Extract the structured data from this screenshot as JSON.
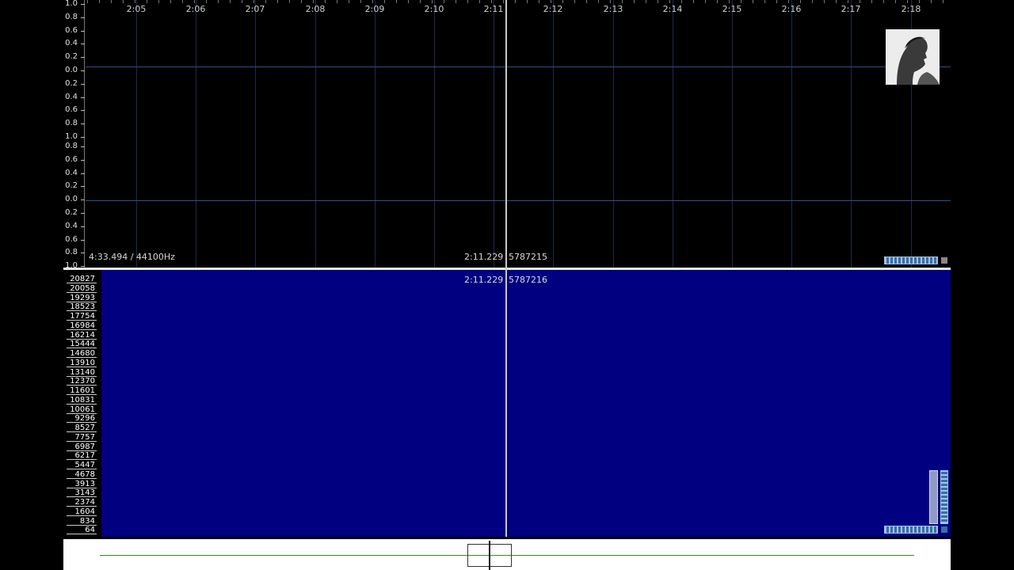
{
  "waveform": {
    "time_ticks": [
      "2:05",
      "2:06",
      "2:07",
      "2:08",
      "2:09",
      "2:10",
      "2:11",
      "2:12",
      "2:13",
      "2:14",
      "2:15",
      "2:16",
      "2:17",
      "2:18"
    ],
    "amplitude_labels_ch1": [
      "1.0",
      "0.8",
      "0.6",
      "0.4",
      "0.2",
      "0.0",
      "0.2",
      "0.4",
      "0.6",
      "0.8",
      "1.0"
    ],
    "amplitude_labels_ch2": [
      "0.8",
      "0.6",
      "0.4",
      "0.2",
      "0.0",
      "0.2",
      "0.4",
      "0.6",
      "0.8",
      "1.0"
    ],
    "duration_rate": "4:33.494 / 44100Hz",
    "cursor_time": "2:11.229",
    "cursor_sample": "5787215"
  },
  "spectrogram": {
    "cursor_time": "2:11.229",
    "cursor_sample": "5787216",
    "frequency_labels": [
      "20827",
      "20058",
      "19293",
      "18523",
      "17754",
      "16984",
      "16214",
      "15444",
      "14680",
      "13910",
      "13140",
      "12370",
      "11601",
      "10831",
      "10061",
      "9296",
      "8527",
      "7757",
      "6987",
      "6217",
      "5447",
      "4678",
      "3913",
      "3143",
      "2374",
      "1604",
      "834",
      "64"
    ],
    "background_color": "#000080"
  },
  "colors": {
    "grid": "#1d2a4a",
    "zero_line": "#2f4f8a",
    "overview_line": "#2e8b2e",
    "zoom_control": "#3a6ea5"
  },
  "icons": {
    "waveform_zoom": "horizontal-zoom-slider-icon",
    "spectrogram_zoom": "horizontal-zoom-slider-icon",
    "vertical_zoom": "vertical-zoom-slider-icon",
    "corner": "square-button-icon"
  }
}
